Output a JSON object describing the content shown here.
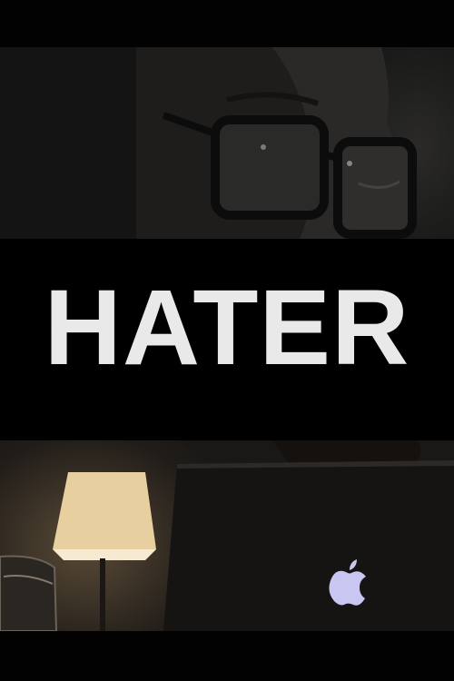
{
  "poster": {
    "title": "HATER"
  },
  "icons": {
    "laptop_logo": "apple-logo-icon"
  },
  "colors": {
    "background": "#000000",
    "title_text": "#e9e9e9",
    "lamp_glow": "#f3dfb8",
    "laptop_logo": "#c9c6f2"
  }
}
